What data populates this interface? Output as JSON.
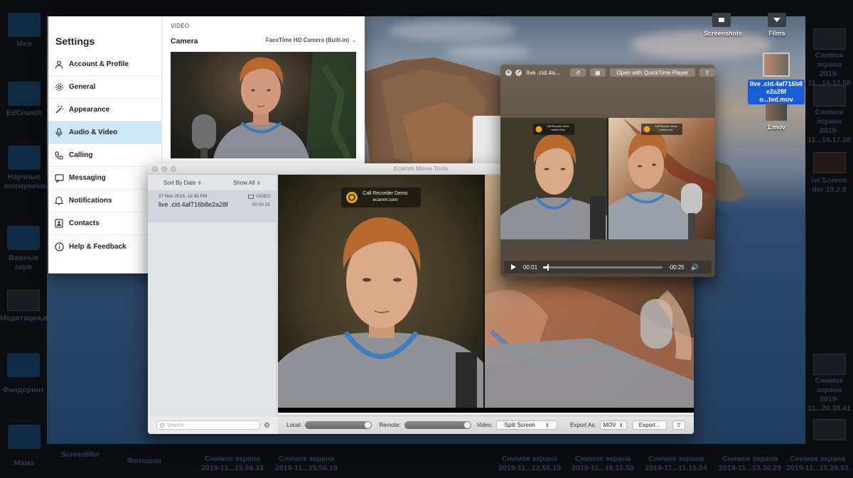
{
  "outer_desktop": {
    "left_icons": [
      "Мел",
      "EdCrunch",
      "Научные коммуникац",
      "Важные скри",
      "Медитация,mp",
      "Фандоринт",
      "Мама"
    ],
    "bottom_icons": [
      {
        "title": "Screenlifer",
        "sub": ""
      },
      {
        "title": "Фотошоп",
        "sub": ""
      },
      {
        "title": "Снимок экрана",
        "sub": "2019-11...19.59.33"
      },
      {
        "title": "Снимок экрана",
        "sub": "2019-11...15.56.19"
      },
      {
        "title": "Снимок экрана",
        "sub": "2019-11...12.56.10"
      },
      {
        "title": "Снимок экрана",
        "sub": "2019-11...16.15.53"
      },
      {
        "title": "Снимок экрана",
        "sub": "2019-11...11.15.24"
      },
      {
        "title": "Снимок экрана",
        "sub": "2019-11...13.30.29"
      },
      {
        "title": "Снимок экрана",
        "sub": "2019-11...15.29.53"
      }
    ],
    "right_icons": [
      {
        "title": "Снимок экрана",
        "sub": "2019-11...16.12.58"
      },
      {
        "title": "Снимок экрана",
        "sub": "2019-11...16.17.38"
      },
      {
        "title": "ivi Screen",
        "sub": "der 10.2.0"
      },
      {
        "title": "Снимок экрана",
        "sub": "2019-11...20.38.41"
      }
    ]
  },
  "desktop_icons": {
    "screenshots": "Screenshots",
    "films": "Films",
    "selected_file": "live .cid.4af716b8 e2a28f o...ted.mov",
    "file2": "1.mov"
  },
  "settings": {
    "title": "Settings",
    "items": [
      {
        "label": "Account & Profile",
        "icon": "person-icon",
        "active": false
      },
      {
        "label": "General",
        "icon": "gear-icon",
        "active": false
      },
      {
        "label": "Appearance",
        "icon": "wand-icon",
        "active": false
      },
      {
        "label": "Audio & Video",
        "icon": "microphone-icon",
        "active": true
      },
      {
        "label": "Calling",
        "icon": "phone-icon",
        "active": false
      },
      {
        "label": "Messaging",
        "icon": "chat-icon",
        "active": false
      },
      {
        "label": "Notifications",
        "icon": "bell-icon",
        "active": false
      },
      {
        "label": "Contacts",
        "icon": "contact-card-icon",
        "active": false
      },
      {
        "label": "Help & Feedback",
        "icon": "info-icon",
        "active": false
      }
    ],
    "section": "VIDEO",
    "camera_label": "Camera",
    "camera_value": "FaceTime HD Camera (Built-in)"
  },
  "ecamm": {
    "title": "Ecamm Movie Tools",
    "sort": "Sort By Date",
    "filter": "Show All",
    "recording": {
      "date": "27 Nov 2019, 12:45 PM",
      "name": "live .cid.4af716b8e2a28f",
      "type": "VIDEO",
      "duration": "00:00:25"
    },
    "search_placeholder": "Search",
    "watermark_title": "Call Recorder Demo",
    "watermark_sub": "ecamm.com",
    "local_label": "Local:",
    "local_level": 1.0,
    "remote_label": "Remote:",
    "remote_level": 1.0,
    "video_label": "Video:",
    "video_value": "Split Screen",
    "export_as_label": "Export As:",
    "export_format": "MOV",
    "export_button": "Export..."
  },
  "quicktime": {
    "title": "live .cid.4a...",
    "open_button": "Open with QuickTime Player",
    "watermark_title": "Call Recorder Demo",
    "watermark_sub": "ecamm.com",
    "time_elapsed": "00:01",
    "time_remaining": "-00:25",
    "progress": 0.04
  },
  "colors": {
    "settings_active": "#cde9f7",
    "desktop_selection": "#1a5bd6"
  }
}
